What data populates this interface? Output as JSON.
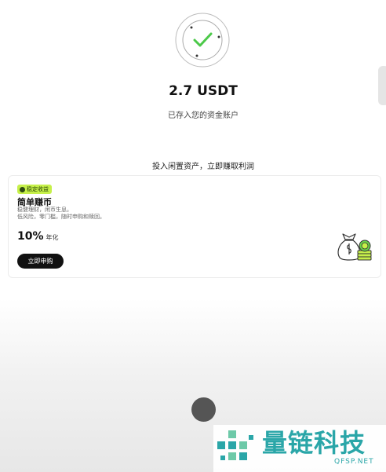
{
  "status": {
    "amount": "2.7 USDT",
    "note": "已存入您的资金账户"
  },
  "promo": {
    "heading": "投入闲置资产，立即赚取利润"
  },
  "product": {
    "badge": "稳定收益",
    "title": "简单赚币",
    "desc_line1": "稳健理财，闲币生息。",
    "desc_line2": "低风险，零门槛，随时申购和赎回。",
    "rate": "10%",
    "rate_unit": "年化",
    "button": "立即申购"
  },
  "watermark": {
    "text": "量链科技",
    "url": "QFSP.NET"
  },
  "colors": {
    "accent": "#c6f04a",
    "check": "#4cc94a",
    "watermark": "#2aa6a8"
  },
  "icons": {
    "status": "check-circle-icon",
    "product": "money-bag-coin-icon"
  }
}
